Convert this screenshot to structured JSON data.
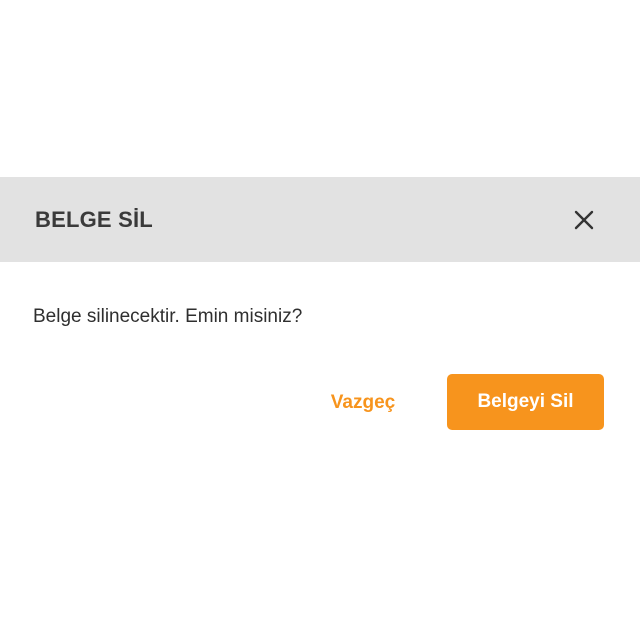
{
  "dialog": {
    "title": "BELGE SİL",
    "message": "Belge silinecektir. Emin misiniz?",
    "cancel_label": "Vazgeç",
    "confirm_label": "Belgeyi Sil",
    "close_icon": "close-icon"
  },
  "colors": {
    "accent": "#f7941d",
    "header_background": "#e2e2e2",
    "title_text": "#3a3a3a",
    "body_text": "#2f2f2f"
  }
}
